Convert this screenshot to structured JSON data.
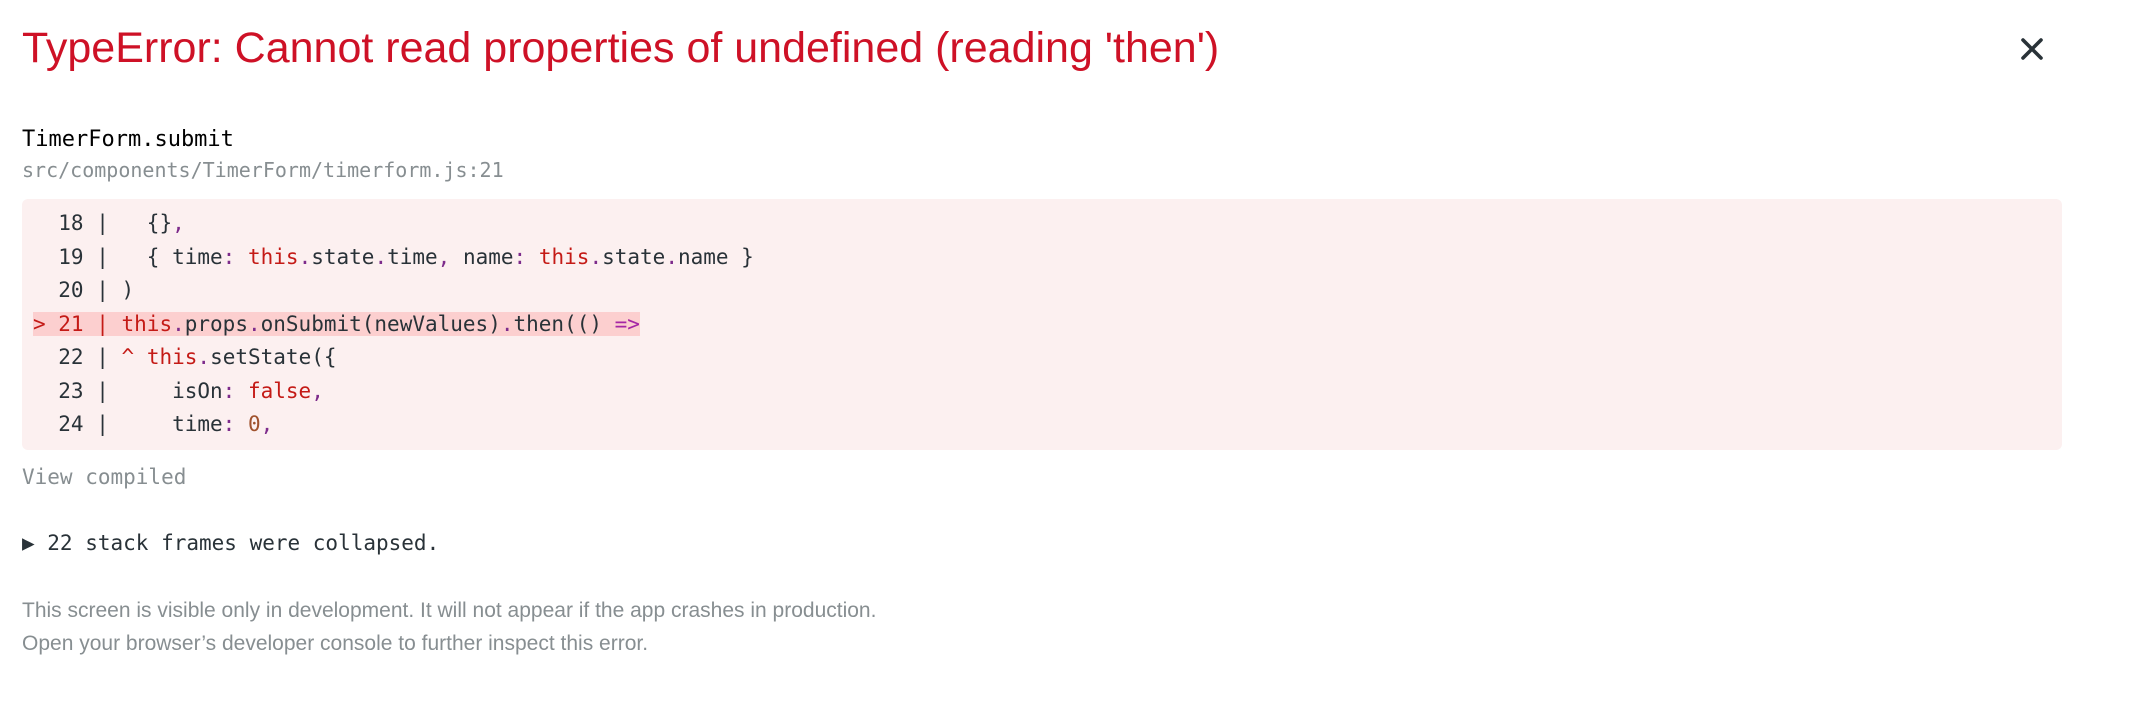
{
  "header": {
    "title": "TypeError: Cannot read properties of undefined (reading 'then')",
    "close_icon": "close-icon"
  },
  "frame": {
    "function_name": "TimerForm.submit",
    "file_location": "src/components/TimerForm/timerform.js:21"
  },
  "code": {
    "lines": [
      {
        "gutter": "  18 | ",
        "segments": [
          {
            "t": "  {}",
            "c": ""
          },
          {
            "t": ",",
            "c": "pn"
          }
        ]
      },
      {
        "gutter": "  19 | ",
        "segments": [
          {
            "t": "  { time",
            "c": ""
          },
          {
            "t": ":",
            "c": "pn"
          },
          {
            "t": " ",
            "c": ""
          },
          {
            "t": "this",
            "c": "kw"
          },
          {
            "t": ".",
            "c": "pn"
          },
          {
            "t": "state",
            "c": ""
          },
          {
            "t": ".",
            "c": "pn"
          },
          {
            "t": "time",
            "c": ""
          },
          {
            "t": ",",
            "c": "pn"
          },
          {
            "t": " name",
            "c": ""
          },
          {
            "t": ":",
            "c": "pn"
          },
          {
            "t": " ",
            "c": ""
          },
          {
            "t": "this",
            "c": "kw"
          },
          {
            "t": ".",
            "c": "pn"
          },
          {
            "t": "state",
            "c": ""
          },
          {
            "t": ".",
            "c": "pn"
          },
          {
            "t": "name }",
            "c": ""
          }
        ]
      },
      {
        "gutter": "  20 | ",
        "segments": [
          {
            "t": ")",
            "c": ""
          }
        ]
      },
      {
        "gutter": "> 21 | ",
        "highlight": true,
        "segments": [
          {
            "t": "this",
            "c": "kw"
          },
          {
            "t": ".",
            "c": "pn"
          },
          {
            "t": "props",
            "c": ""
          },
          {
            "t": ".",
            "c": "pn"
          },
          {
            "t": "onSubmit(newValues)",
            "c": ""
          },
          {
            "t": ".",
            "c": "pn"
          },
          {
            "t": "then(() ",
            "c": ""
          },
          {
            "t": "=>",
            "c": "kw2"
          }
        ]
      },
      {
        "gutter": "  22 | ",
        "segments": [
          {
            "t": "^",
            "c": "kw"
          },
          {
            "t": " ",
            "c": ""
          },
          {
            "t": "this",
            "c": "kw"
          },
          {
            "t": ".",
            "c": "pn"
          },
          {
            "t": "setState({",
            "c": ""
          }
        ]
      },
      {
        "gutter": "  23 | ",
        "segments": [
          {
            "t": "    isOn",
            "c": ""
          },
          {
            "t": ":",
            "c": "pn"
          },
          {
            "t": " ",
            "c": ""
          },
          {
            "t": "false",
            "c": "kw"
          },
          {
            "t": ",",
            "c": "pn"
          }
        ]
      },
      {
        "gutter": "  24 | ",
        "segments": [
          {
            "t": "    time",
            "c": ""
          },
          {
            "t": ":",
            "c": "pn"
          },
          {
            "t": " ",
            "c": ""
          },
          {
            "t": "0",
            "c": "num"
          },
          {
            "t": ",",
            "c": "pn"
          }
        ]
      }
    ]
  },
  "view_compiled_label": "View compiled",
  "collapsed_frames_label": "▶ 22 stack frames were collapsed.",
  "footer": {
    "line1": "This screen is visible only in development. It will not appear if the app crashes in production.",
    "line2": "Open your browser’s developer console to further inspect this error."
  },
  "colors": {
    "error_red": "#ce1126",
    "code_bg": "#fcf0f0",
    "highlight_bg": "#fccfcf",
    "muted_gray": "#878e91"
  }
}
